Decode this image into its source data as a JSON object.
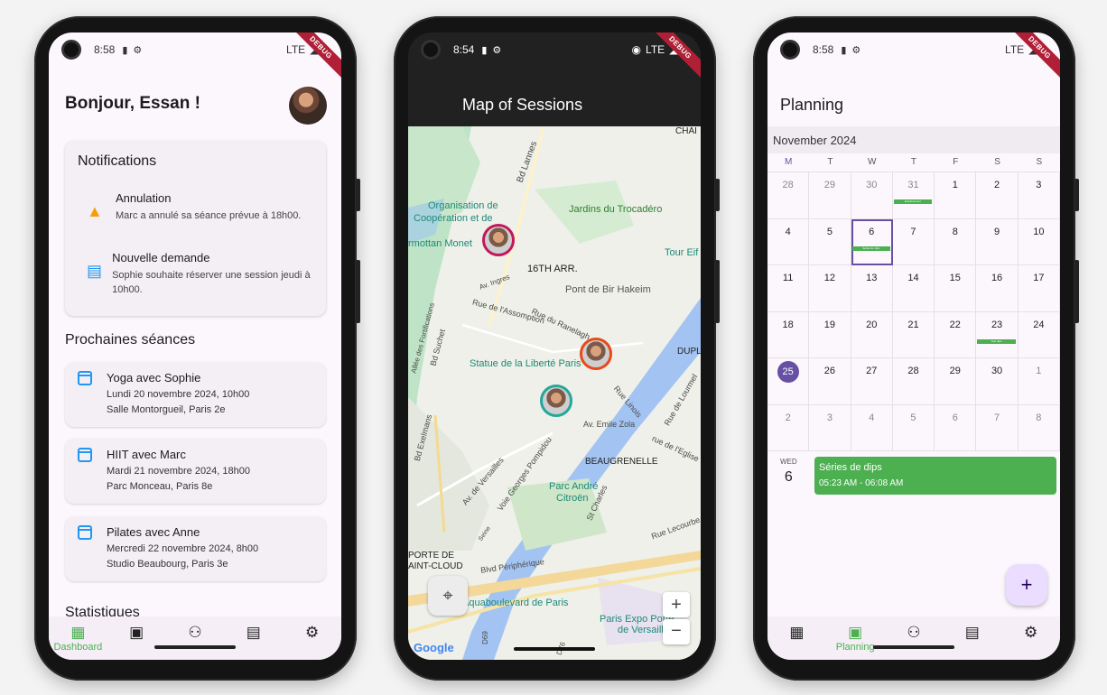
{
  "phone1": {
    "status": {
      "time": "8:58",
      "network": "LTE"
    },
    "debug": "DEBUG",
    "greeting": "Bonjour, Essan !",
    "notifications": {
      "title": "Notifications",
      "items": [
        {
          "title": "Annulation",
          "text": "Marc a annulé sa séance prévue à 18h00.",
          "icon": "warning-icon"
        },
        {
          "title": "Nouvelle demande",
          "text": "Sophie souhaite réserver une session jeudi à 10h00.",
          "icon": "message-icon"
        }
      ]
    },
    "upcoming_title": "Prochaines séances",
    "sessions": [
      {
        "title": "Yoga avec Sophie",
        "date": "Lundi 20 novembre 2024, 10h00",
        "place": "Salle Montorgueil, Paris 2e"
      },
      {
        "title": "HIIT avec Marc",
        "date": "Mardi 21 novembre 2024, 18h00",
        "place": "Parc Monceau, Paris 8e"
      },
      {
        "title": "Pilates avec Anne",
        "date": "Mercredi 22 novembre 2024, 8h00",
        "place": "Studio Beaubourg, Paris 3e"
      }
    ],
    "stats_title": "Statistiques",
    "nav": {
      "dashboard": "Dashboard"
    }
  },
  "phone2": {
    "status": {
      "time": "8:54",
      "network": "LTE"
    },
    "debug": "DEBUG",
    "title": "Map of Sessions",
    "map_labels": {
      "org": "Organisation de",
      "coop": "Coopération et de",
      "marmottan": "rmottan Monet",
      "trocadero": "Jardins du Trocadéro",
      "tour": "Tour Eif",
      "arr": "16TH ARR.",
      "bir": "Pont de Bir Hakeim",
      "liberte": "Statue de la Liberté Paris",
      "citroen1": "Parc André",
      "citroen2": "Citroën",
      "beaugrenelle": "BEAUGRENELLE",
      "porte1": "PORTE DE",
      "porte2": "AINT-CLOUD",
      "aquaboulevard": "Aquaboulevard de Paris",
      "expo1": "Paris Expo Porte",
      "expo2": "de Versaille",
      "lannes": "Bd Lannes",
      "ingres": "Av. Ingres",
      "assomption": "Rue de l'Assomption",
      "ranelagh": "Rue du Ranelagh",
      "suchet": "Bd Suchet",
      "fortifs": "Allée des Fortifications",
      "zola": "Av. Emile Zola",
      "eglise": "rue de l'Eglise",
      "lourmel": "Rue de Lourmel",
      "linois": "Rue Linois",
      "versailles": "Av. de Versailles",
      "pompidou": "Voie Georges Pompidou",
      "seine": "Seine",
      "charles": "St Charles",
      "lecourbe": "Rue Lecourbe",
      "peripherique": "Blvd Périphérique",
      "exelmans": "Bd Exelmans",
      "chai": "CHAI",
      "dupl": "DUPL",
      "d76": "D76",
      "d69": "D69",
      "google": "Google"
    }
  },
  "phone3": {
    "status": {
      "time": "8:58",
      "network": "LTE"
    },
    "debug": "DEBUG",
    "title": "Planning",
    "month": "November 2024",
    "weekdays": [
      "M",
      "T",
      "W",
      "T",
      "F",
      "S",
      "S"
    ],
    "days": [
      "28",
      "29",
      "30",
      "31",
      "1",
      "2",
      "3",
      "4",
      "5",
      "6",
      "7",
      "8",
      "9",
      "10",
      "11",
      "12",
      "13",
      "14",
      "15",
      "16",
      "17",
      "18",
      "19",
      "20",
      "21",
      "22",
      "23",
      "24",
      "25",
      "26",
      "27",
      "28",
      "29",
      "30",
      "1",
      "2",
      "3",
      "4",
      "5",
      "6",
      "7",
      "8"
    ],
    "event_day": {
      "weekday": "WED",
      "day": "6"
    },
    "event": {
      "title": "Séries de dips",
      "time": "05:23 AM - 06:08 AM"
    },
    "mini_events": {
      "oct31": "Entraînement",
      "nov6": "Séries de dips",
      "nov23": "Test dips"
    },
    "fab": "+",
    "nav": {
      "planning": "Planning"
    }
  }
}
